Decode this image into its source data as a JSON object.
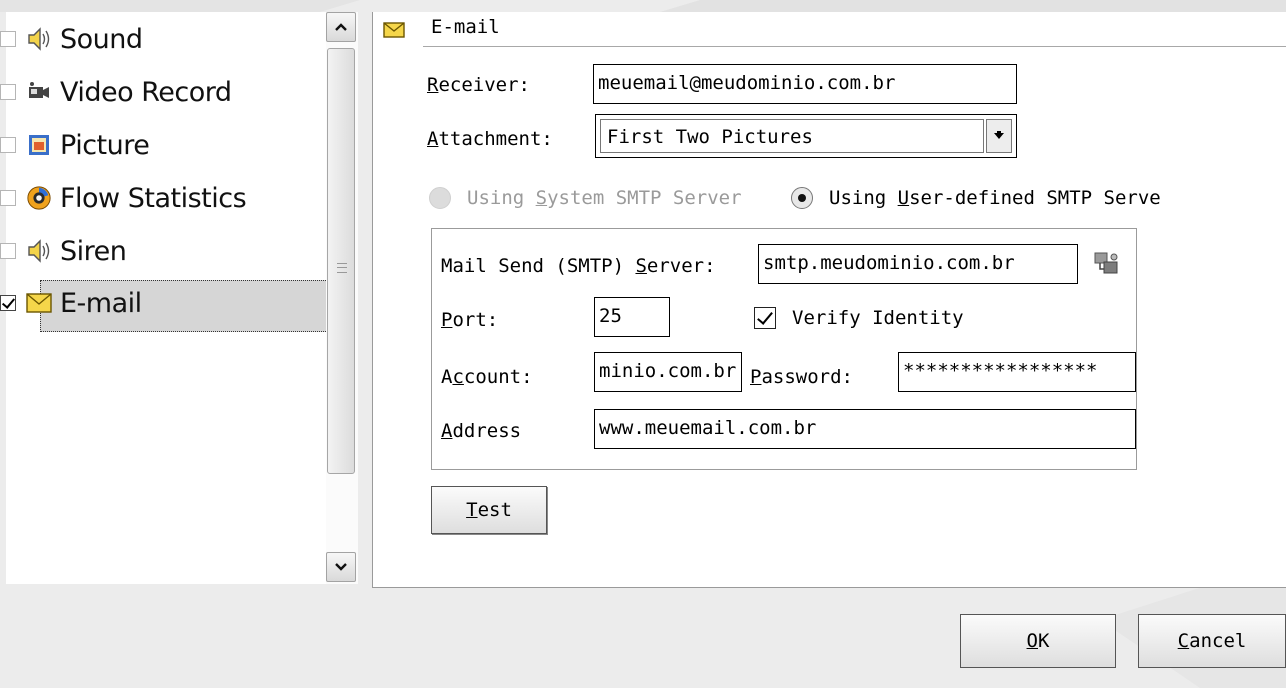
{
  "list": {
    "items": [
      {
        "label": "Sound",
        "icon": "speaker-icon",
        "checked": false
      },
      {
        "label": "Video Record",
        "icon": "video-camera-icon",
        "checked": false
      },
      {
        "label": "Picture",
        "icon": "picture-icon",
        "checked": false
      },
      {
        "label": "Flow Statistics",
        "icon": "flow-statistics-icon",
        "checked": false
      },
      {
        "label": "Siren",
        "icon": "speaker-icon",
        "checked": false
      },
      {
        "label": "E-mail",
        "icon": "envelope-icon",
        "checked": true
      }
    ]
  },
  "panel": {
    "title": "E-mail",
    "receiver": {
      "pre": "",
      "accel": "R",
      "post": "eceiver:",
      "value": "meuemail@meudominio.com.br"
    },
    "attachment": {
      "pre": "",
      "accel": "A",
      "post": "ttachment:",
      "value": "First Two Pictures"
    },
    "radio_system": {
      "pre": "Using ",
      "accel": "S",
      "post": "ystem SMTP Server",
      "selected": false,
      "enabled": false
    },
    "radio_user": {
      "pre": "Using ",
      "accel": "U",
      "post": "ser-defined SMTP Serve",
      "selected": true
    },
    "smtp_server": {
      "pre": "Mail Send (SMTP) ",
      "accel": "S",
      "post": "erver:",
      "value": "smtp.meudominio.com.br"
    },
    "port": {
      "pre": "",
      "accel": "P",
      "post": "ort:",
      "value": "25"
    },
    "verify": {
      "label": "Verify Identity",
      "checked": true
    },
    "account": {
      "pre": "A",
      "accel": "c",
      "post": "count:",
      "value": "minio.com.br"
    },
    "password": {
      "pre": "",
      "accel": "P",
      "post": "assword:",
      "value": "*****************"
    },
    "address": {
      "pre": "",
      "accel": "A",
      "post": "ddress",
      "value": "www.meuemail.com.br"
    },
    "test_button": {
      "pre": "",
      "accel": "T",
      "post": "est"
    }
  },
  "footer": {
    "ok": {
      "pre": "",
      "accel": "O",
      "post": "K"
    },
    "cancel": {
      "pre": "",
      "accel": "C",
      "post": "ancel"
    }
  }
}
